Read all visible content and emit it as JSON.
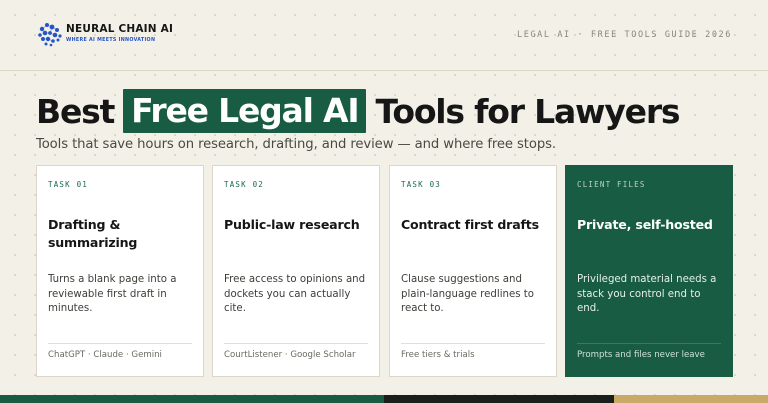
{
  "header": {
    "logo_name": "NEURAL CHAIN AI",
    "logo_tagline": "WHERE AI MEETS INNOVATION",
    "guide_label": "LEGAL AI · FREE TOOLS GUIDE 2026"
  },
  "hero": {
    "title_before": "Best",
    "title_highlight": "Free Legal AI",
    "title_after": "Tools for Lawyers",
    "subtitle": "Tools that save hours on research, drafting, and review — and where free stops."
  },
  "cards": [
    {
      "tag": "TASK 01",
      "title": "Drafting & summarizing",
      "description": "Turns a blank page into a reviewable first draft in minutes.",
      "footer": "ChatGPT · Claude · Gemini"
    },
    {
      "tag": "TASK 02",
      "title": "Public-law research",
      "description": "Free access to opinions and dockets you can actually cite.",
      "footer": "CourtListener · Google Scholar"
    },
    {
      "tag": "TASK 03",
      "title": "Contract first drafts",
      "description": "Clause suggestions and plain-language redlines to react to.",
      "footer": "Free tiers & trials"
    },
    {
      "tag": "CLIENT FILES",
      "title": "Private, self-hosted",
      "description": "Privileged material needs a stack you control end to end.",
      "footer": "Prompts and files never leave"
    }
  ],
  "colors": {
    "accent_green": "#175c43",
    "background": "#f3f0e8",
    "bar_dark": "#1a1f1c",
    "bar_gold": "#c9a96a",
    "logo_blue": "#2754c5"
  },
  "icons": {
    "logo": "neural-network-brain-icon"
  }
}
